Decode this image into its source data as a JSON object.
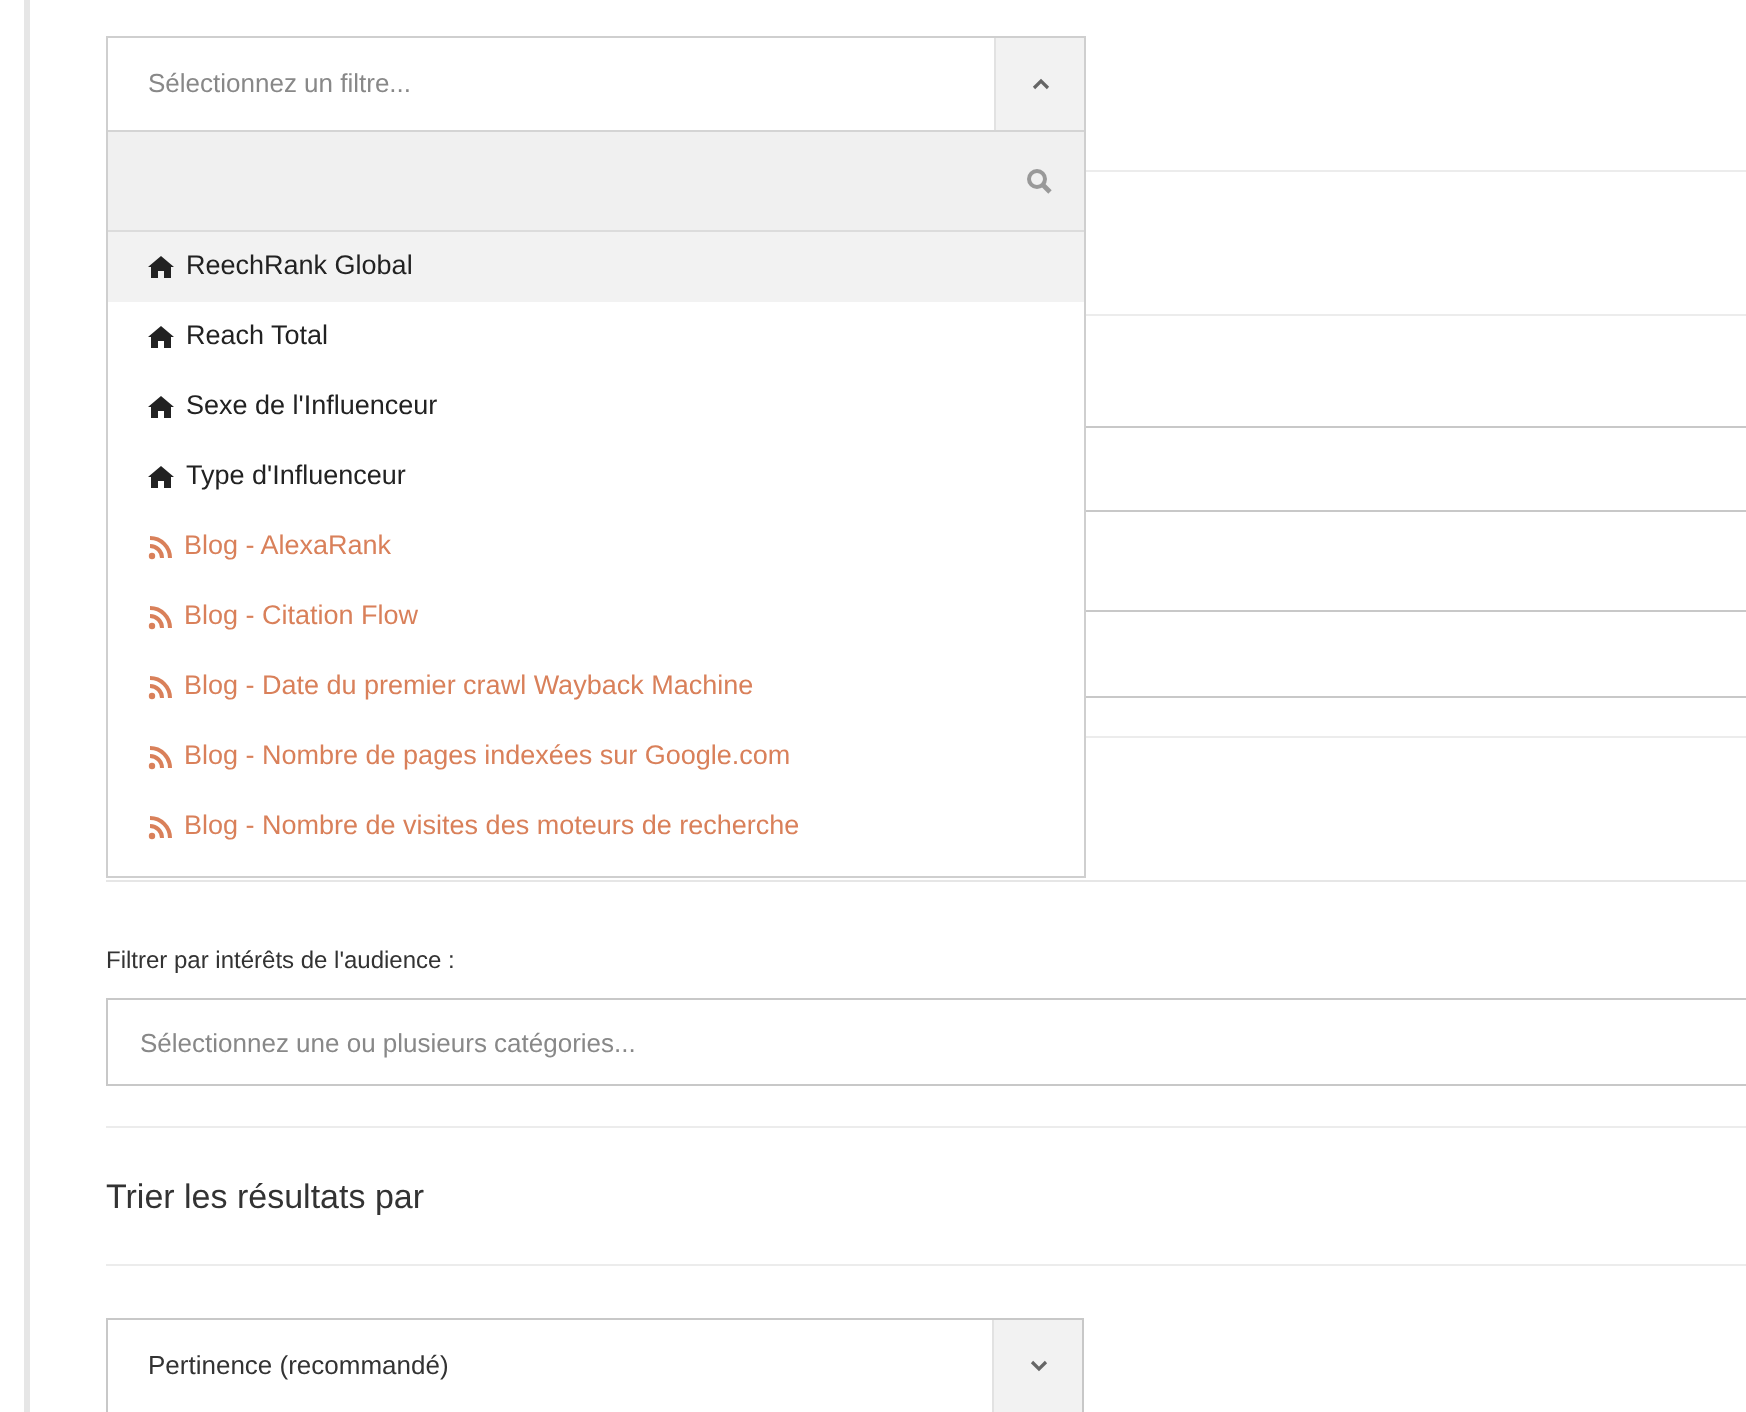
{
  "filter_select": {
    "placeholder": "Sélectionnez un filtre...",
    "expanded": true,
    "options": [
      {
        "label": "ReechRank Global",
        "kind": "home",
        "selected": true
      },
      {
        "label": "Reach Total",
        "kind": "home",
        "selected": false
      },
      {
        "label": "Sexe de l'Influenceur",
        "kind": "home",
        "selected": false
      },
      {
        "label": "Type d'Influenceur",
        "kind": "home",
        "selected": false
      },
      {
        "label": "Blog - AlexaRank",
        "kind": "rss",
        "selected": false
      },
      {
        "label": "Blog - Citation Flow",
        "kind": "rss",
        "selected": false
      },
      {
        "label": "Blog - Date du premier crawl Wayback Machine",
        "kind": "rss",
        "selected": false
      },
      {
        "label": "Blog - Nombre de pages indexées sur Google.com",
        "kind": "rss",
        "selected": false
      },
      {
        "label": "Blog - Nombre de visites des moteurs de recherche",
        "kind": "rss",
        "selected": false
      }
    ]
  },
  "audience_filter": {
    "label": "Filtrer par intérêts de l'audience :",
    "placeholder": "Sélectionnez une ou plusieurs catégories..."
  },
  "sort": {
    "heading": "Trier les résultats par",
    "value": "Pertinence (recommandé)",
    "expanded": false
  }
}
